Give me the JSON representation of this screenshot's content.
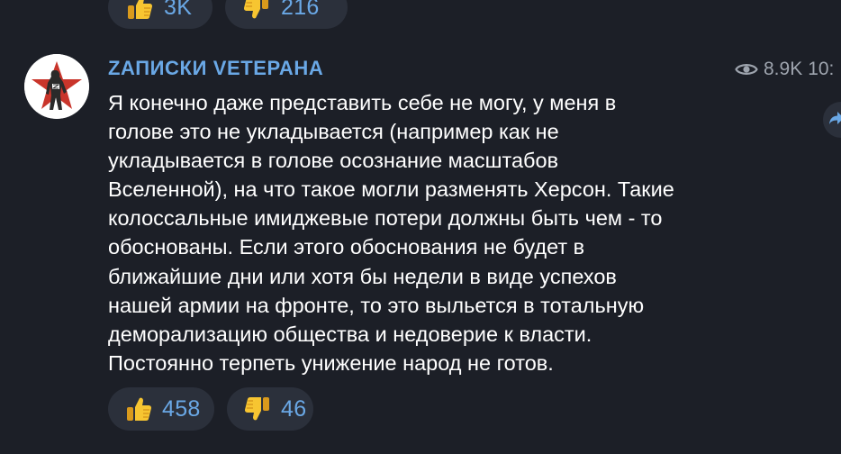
{
  "previous_post": {
    "reactions": [
      {
        "emoji": "thumbs-up",
        "count": "3K"
      },
      {
        "emoji": "thumbs-down",
        "count": "216"
      }
    ]
  },
  "post": {
    "channel_name": "ZАПИСКИ VЕТЕРАНА",
    "views": "8.9K",
    "time": "10:",
    "lines": [
      "Я конечно даже представить себе не могу, у меня в",
      "голове это не укладывается (например как не",
      "укладывается в голове осознание масштабов",
      "Вселенной), на что такое могли разменять Херсон. Такие",
      "колоссальные имиджевые потери должны быть чем - то",
      "обоснованы. Если этого обоснования не будет в",
      "ближайшие дни или хотя бы недели в виде успехов",
      "нашей армии на фронте, то это выльется в тотальную",
      "деморализацию общества и недоверие к власти.",
      "Постоянно терпеть унижение народ не готов."
    ],
    "reactions": [
      {
        "emoji": "thumbs-up",
        "count": "458"
      },
      {
        "emoji": "thumbs-down",
        "count": "46"
      }
    ]
  },
  "colors": {
    "background": "#1c1f27",
    "accent": "#6aa8e6",
    "reaction_bg": "#2b303b",
    "muted": "#9ea4ae",
    "emoji_yellow": "#f7c531"
  },
  "icons": [
    "thumbs-up-icon",
    "thumbs-down-icon",
    "eye-icon",
    "share-icon",
    "channel-avatar"
  ]
}
